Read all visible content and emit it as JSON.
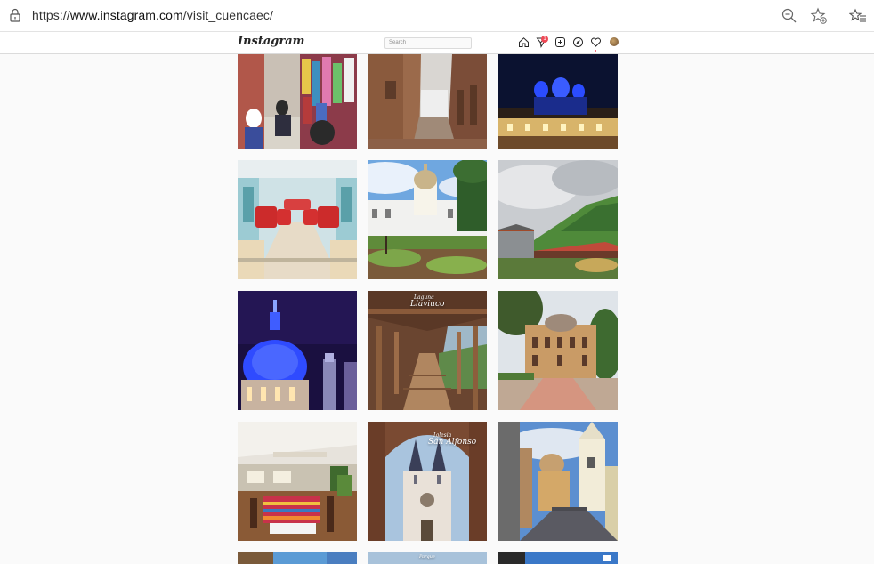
{
  "browser": {
    "url_prefix": "https://",
    "url_host": "www.instagram.com",
    "url_path": "/visit_cuencaec/"
  },
  "instagram": {
    "logo": "Instagram",
    "search_placeholder": "Search",
    "notification_count": "1"
  },
  "posts": [
    {
      "name": "market-textiles"
    },
    {
      "name": "colonial-street"
    },
    {
      "name": "blue-cathedral-night"
    },
    {
      "name": "red-seat-tram"
    },
    {
      "name": "white-church-park"
    },
    {
      "name": "green-hills-bridge"
    },
    {
      "name": "blue-dome-closeup"
    },
    {
      "name": "wooden-bridge-llaviuco",
      "caption_small": "Laguna",
      "caption_big": "Llaviuco"
    },
    {
      "name": "courthouse-plaza"
    },
    {
      "name": "restaurant-interior"
    },
    {
      "name": "church-san-alfonso",
      "caption_small": "Iglesia",
      "caption_big": "San Alfonso"
    },
    {
      "name": "street-towers"
    },
    {
      "name": "partial-sky-1"
    },
    {
      "name": "partial-sign",
      "caption_small": "Parque"
    },
    {
      "name": "partial-sky-2"
    }
  ],
  "colors": {
    "accent_red": "#ed4956",
    "border": "#dbdbdb",
    "background": "#fafafa"
  }
}
